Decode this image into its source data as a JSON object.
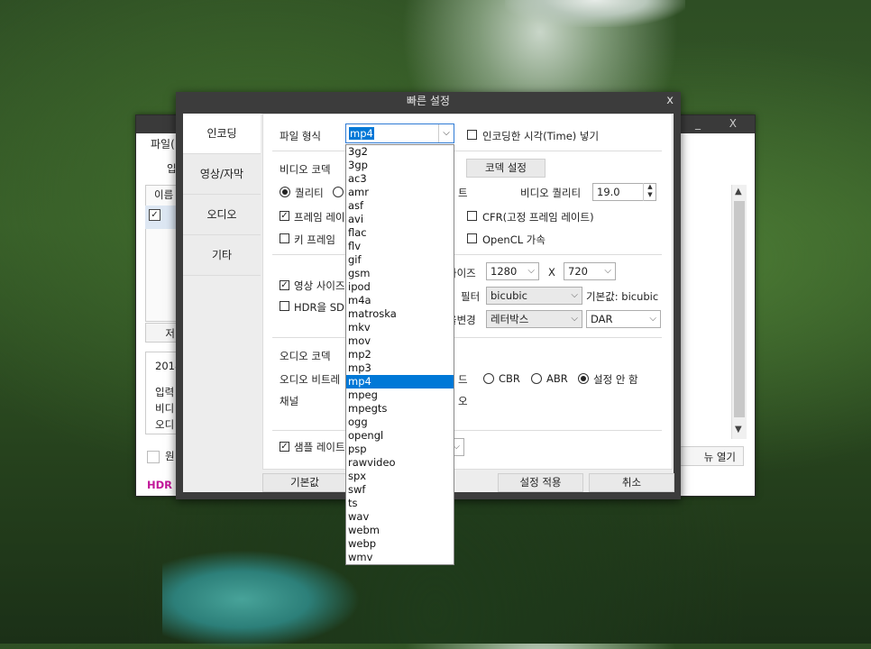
{
  "background_window": {
    "controls": "_  X",
    "menu_file": "파일(",
    "input_tab": "입",
    "list_header": "이름",
    "left_button": "저",
    "info_lines": [
      "2018",
      "입력",
      "비디",
      "오디"
    ],
    "hdr_badge": "HDR",
    "checkbox_label": "원",
    "menu_open_button": "뉴 열기"
  },
  "dialog": {
    "title": "빠른 설정",
    "close": "x",
    "nav": [
      "인코딩",
      "영상/자막",
      "오디오",
      "기타"
    ],
    "labels": {
      "file_format": "파일 형식",
      "insert_time": "인코딩한 시각(Time) 넣기",
      "video_codec": "비디오 코덱",
      "codec_settings": "코덱 설정",
      "quality": "퀄리티",
      "rate_partial": "트",
      "video_quality": "비디오 퀄리티",
      "video_quality_value": "19.0",
      "frame_rate": "프레임 레이",
      "cfr": "CFR(고정 프레임 레이트)",
      "key_frame": "키 프레임",
      "opencl": "OpenCL 가속",
      "video_size": "영상 사이즈",
      "size_partial": "사이즈",
      "width": "1280",
      "x": "X",
      "height": "720",
      "filter_partial": "필터",
      "filter": "bicubic",
      "filter_default": "기본값: bicubic",
      "hdr_sdr": "HDR을 SDR",
      "ratio_partial": "율변경",
      "letterbox": "레터박스",
      "dar": "DAR",
      "audio_codec": "오디오 코덱",
      "audio_bitrate": "오디오 비트레",
      "mode_partial": "드",
      "cbr": "CBR",
      "abr": "ABR",
      "no_setting": "설정 안 함",
      "channel": "채널",
      "channel_partial": "오",
      "sample_rate": "샘플 레이트"
    },
    "buttons": {
      "default": "기본값",
      "apply": "설정 적용",
      "cancel": "취소"
    },
    "format_selected": "mp4",
    "format_options": [
      "3g2",
      "3gp",
      "ac3",
      "amr",
      "asf",
      "avi",
      "flac",
      "flv",
      "gif",
      "gsm",
      "ipod",
      "m4a",
      "matroska",
      "mkv",
      "mov",
      "mp2",
      "mp3",
      "mp4",
      "mpeg",
      "mpegts",
      "ogg",
      "opengl",
      "psp",
      "rawvideo",
      "spx",
      "swf",
      "ts",
      "wav",
      "webm",
      "webp",
      "wmv"
    ]
  }
}
